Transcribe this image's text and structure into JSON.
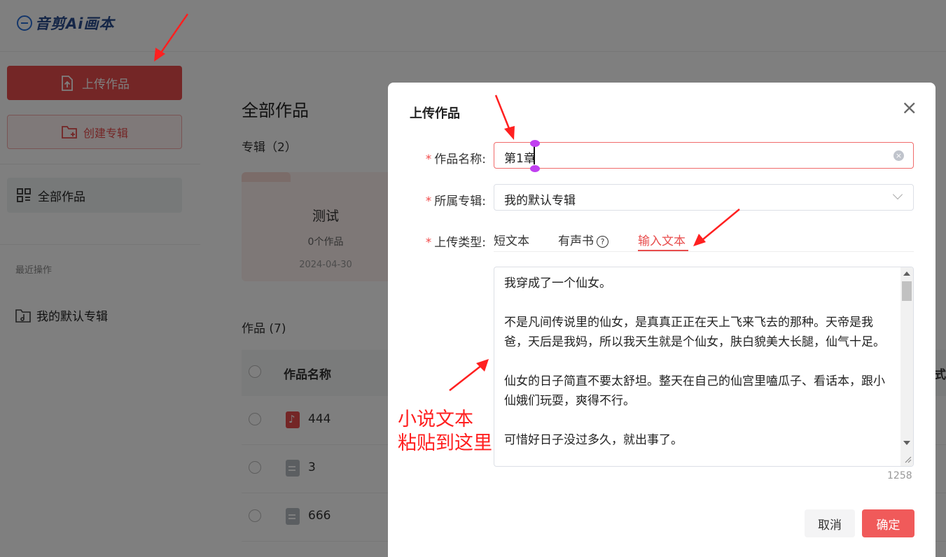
{
  "app": {
    "logo_text": "音剪Ai画本"
  },
  "sidebar": {
    "upload_label": "上传作品",
    "create_album_label": "创建专辑",
    "all_works_label": "全部作品",
    "recent_label": "最近操作",
    "recent_items": [
      {
        "label": "我的默认专辑"
      }
    ]
  },
  "main": {
    "title": "全部作品",
    "albums_heading": "专辑（2）",
    "album_card": {
      "name": "测试",
      "count": "0个作品",
      "date": "2024-04-30"
    },
    "works_heading": "作品 (7)",
    "table": {
      "col_name": "作品名称",
      "col_right_partial": "式",
      "rows": [
        {
          "name": "444",
          "type": "music"
        },
        {
          "name": "3",
          "type": "doc"
        },
        {
          "name": "666",
          "type": "doc"
        }
      ]
    }
  },
  "modal": {
    "title": "上传作品",
    "close_glyph": "×",
    "name_label": "作品名称:",
    "name_value": "第1章",
    "album_label": "所属专辑:",
    "album_value": "我的默认专辑",
    "type_label": "上传类型:",
    "required_mark": "*",
    "tabs": {
      "short": "短文本",
      "audiobook": "有声书",
      "input": "输入文本",
      "help_glyph": "?"
    },
    "text_paragraphs": [
      "我穿成了一个仙女。",
      "不是凡间传说里的仙女，是真真正正在天上飞来飞去的那种。天帝是我爸，天后是我妈，所以我天生就是个仙女，肤白貌美大长腿，仙气十足。",
      "仙女的日子简直不要太舒坦。整天在自己的仙宫里嗑瓜子、看话本，跟小仙娥们玩耍，爽得不行。",
      "可惜好日子没过多久，就出事了。"
    ],
    "char_count": "1258",
    "cancel_label": "取消",
    "ok_label": "确定"
  },
  "annotation": {
    "line1": "小说文本",
    "line2": "粘贴到这里"
  },
  "colors": {
    "accent": "#e84c4c",
    "annotation": "#ff2020",
    "overlay": "rgba(0,0,0,0.5)"
  }
}
